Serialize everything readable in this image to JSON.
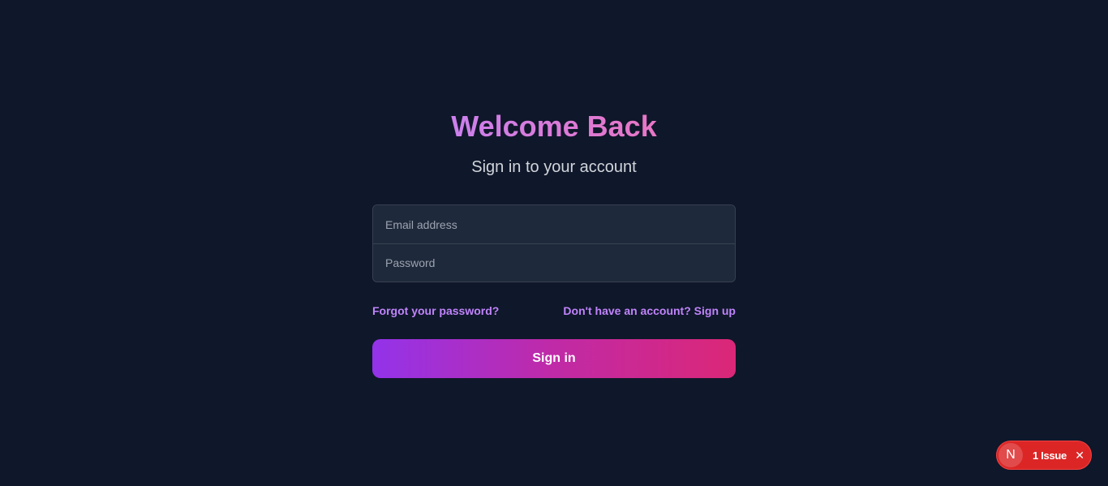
{
  "auth": {
    "title": "Welcome Back",
    "subtitle": "Sign in to your account",
    "email_placeholder": "Email address",
    "password_placeholder": "Password",
    "forgot_password": "Forgot your password?",
    "signup_prompt": "Don't have an account? Sign up",
    "signin_label": "Sign in"
  },
  "dev_overlay": {
    "logo_letter": "N",
    "issue_label": "1 Issue",
    "close_glyph": "✕"
  },
  "colors": {
    "background": "#0f172a",
    "accent_purple": "#c084fc",
    "accent_pink": "#db2777",
    "issue_red": "#dc2626"
  }
}
